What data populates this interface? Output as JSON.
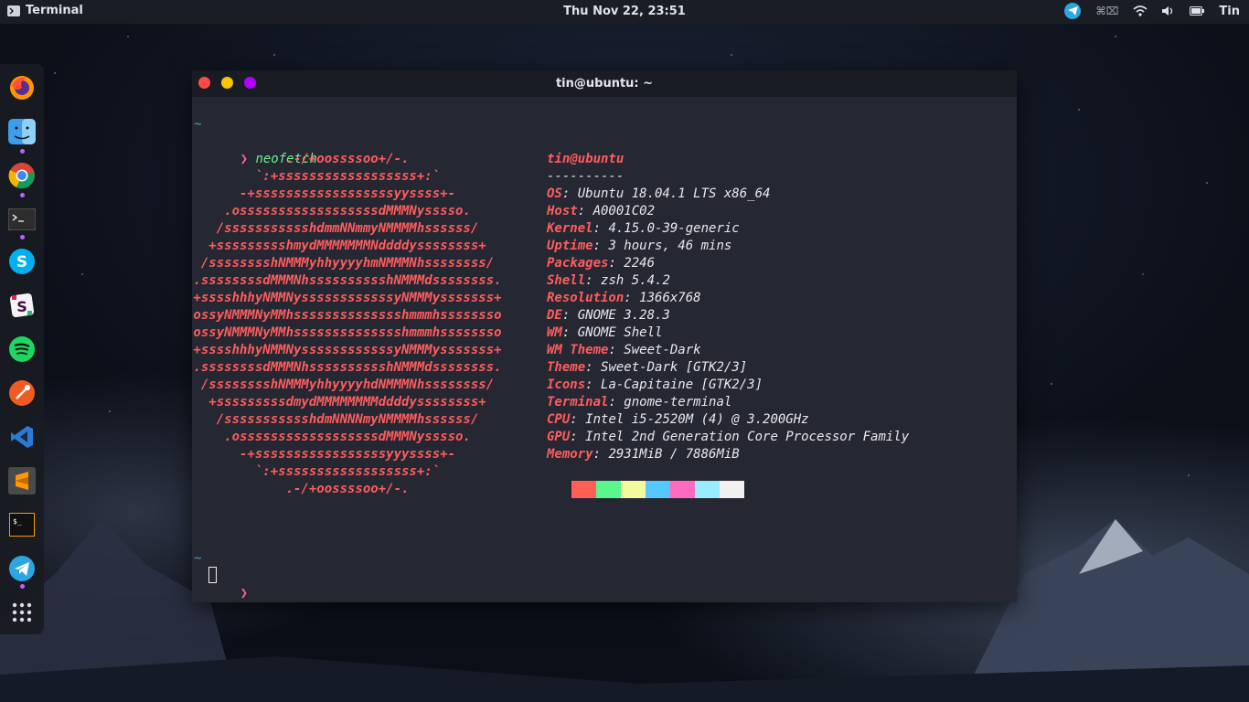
{
  "topbar": {
    "app_name": "Terminal",
    "clock": "Thu Nov 22, 23:51",
    "user": "Tin"
  },
  "dock": {
    "items": [
      {
        "name": "firefox-icon",
        "color": "#ff7139"
      },
      {
        "name": "finder-icon",
        "color": "#3d9de8"
      },
      {
        "name": "chrome-icon",
        "color": "#4caf50"
      },
      {
        "name": "terminal-icon",
        "color": "#3a3a3a"
      },
      {
        "name": "skype-icon",
        "color": "#00aff0"
      },
      {
        "name": "slack-icon",
        "color": "#ffffff"
      },
      {
        "name": "spotify-icon",
        "color": "#1ed760"
      },
      {
        "name": "postman-icon",
        "color": "#ef5b25"
      },
      {
        "name": "vscode-icon",
        "color": "#2b7bd6"
      },
      {
        "name": "sublime-text-icon",
        "color": "#ff9800"
      },
      {
        "name": "hyper-terminal-icon",
        "color": "#111111"
      },
      {
        "name": "telegram-icon",
        "color": "#2ca5e0"
      },
      {
        "name": "show-applications-icon",
        "color": "#dddddd"
      }
    ]
  },
  "window": {
    "title": "tin@ubuntu: ~"
  },
  "terminal": {
    "tilde": "~",
    "prompt_symbol": "❯",
    "command": "neofetch",
    "logo_lines": [
      "             .-/+oossssoo+/-.",
      "         `:+ssssssssssssssssss+:`",
      "       -+ssssssssssssssssssyyssss+-",
      "     .ossssssssssssssssssdMMMNysssso.",
      "    /ssssssssssshdmmNNmmyNMMMMhssssss/",
      "   +ssssssssshmydMMMMMMMNddddyssssssss+",
      "  /sssssssshNMMMyhhyyyyhmNMMMNhssssssss/",
      " .ssssssssdMMMNhsssssssssshNMMMdssssssss.",
      " +sssshhhyNMMNyssssssssssssyNMMMysssssss+",
      " ossyNMMMNyMMhsssssssssssssshmmmhssssssso",
      " ossyNMMMNyMMhsssssssssssssshmmmhssssssso",
      " +sssshhhyNMMNyssssssssssssyNMMMysssssss+",
      " .ssssssssdMMMNhsssssssssshNMMMdssssssss.",
      "  /sssssssshNMMMyhhyyyyhdNMMMNhssssssss/",
      "   +sssssssssdmydMMMMMMMMddddyssssssss+",
      "    /ssssssssssshdmNNNNmyNMMMMhssssss/",
      "     .ossssssssssssssssssdMMMNysssso.",
      "       -+sssssssssssssssssyyyssss+-",
      "         `:+ssssssssssssssssss+:`",
      "             .-/+oossssoo+/-."
    ],
    "user_host": "tin@ubuntu",
    "separator": "----------",
    "info": [
      {
        "key": "OS",
        "value": "Ubuntu 18.04.1 LTS x86_64"
      },
      {
        "key": "Host",
        "value": "A0001C02"
      },
      {
        "key": "Kernel",
        "value": "4.15.0-39-generic"
      },
      {
        "key": "Uptime",
        "value": "3 hours, 46 mins"
      },
      {
        "key": "Packages",
        "value": "2246"
      },
      {
        "key": "Shell",
        "value": "zsh 5.4.2"
      },
      {
        "key": "Resolution",
        "value": "1366x768"
      },
      {
        "key": "DE",
        "value": "GNOME 3.28.3"
      },
      {
        "key": "WM",
        "value": "GNOME Shell"
      },
      {
        "key": "WM Theme",
        "value": "Sweet-Dark"
      },
      {
        "key": "Theme",
        "value": "Sweet-Dark [GTK2/3]"
      },
      {
        "key": "Icons",
        "value": "La-Capitaine [GTK2/3]"
      },
      {
        "key": "Terminal",
        "value": "gnome-terminal"
      },
      {
        "key": "CPU",
        "value": "Intel i5-2520M (4) @ 3.200GHz"
      },
      {
        "key": "GPU",
        "value": "Intel 2nd Generation Core Processor Family"
      },
      {
        "key": "Memory",
        "value": "2931MiB / 7886MiB"
      }
    ],
    "palette": [
      "#ff5f56",
      "#5af78e",
      "#f3f99d",
      "#57c7ff",
      "#ff6ac1",
      "#9aedfe",
      "#f1f1f0"
    ]
  }
}
